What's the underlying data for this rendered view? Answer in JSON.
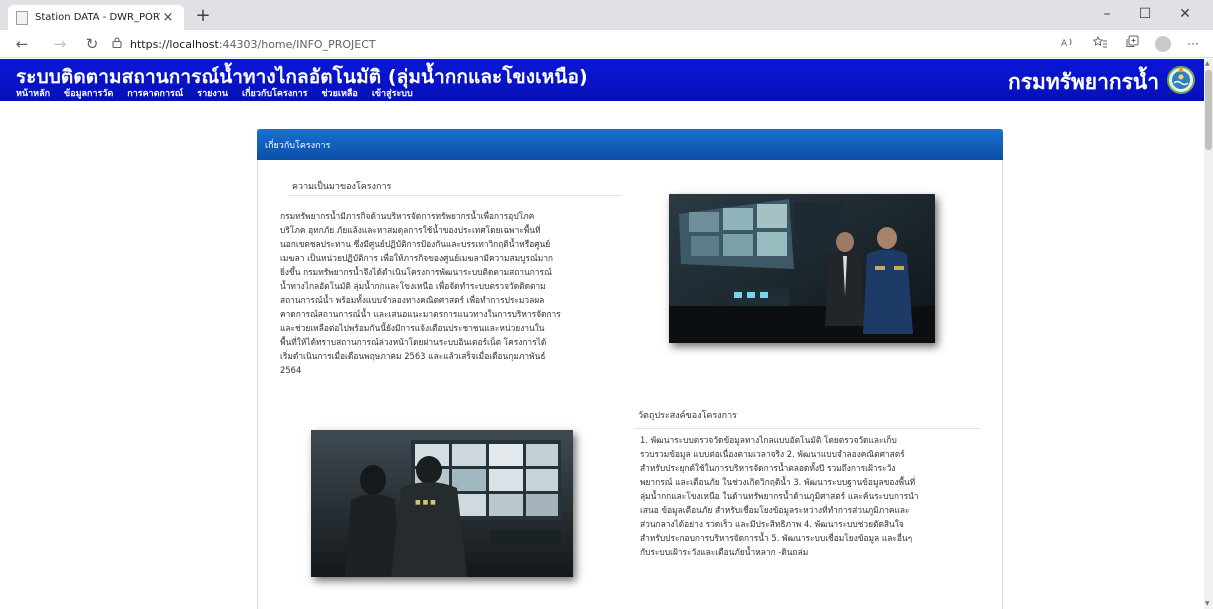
{
  "browser": {
    "tab_title": "Station DATA - DWR_PORTAL",
    "tab_close": "×",
    "new_tab": "+",
    "url_host": "https://localhost",
    "url_rest": ":44303/home/INFO_PROJECT"
  },
  "site": {
    "title": "ระบบติดตามสถานการณ์น้ำทางไกลอัตโนมัติ (ลุ่มน้ำกกและโขงเหนือ)",
    "department": "กรมทรัพยากรน้ำ",
    "nav": [
      "หน้าหลัก",
      "ข้อมูลการวัด",
      "การคาดการณ์",
      "รายงาน",
      "เกี่ยวกับโครงการ",
      "ช่วยเหลือ",
      "เข้าสู่ระบบ"
    ]
  },
  "panel": {
    "title": "เกี่ยวกับโครงการ",
    "background_title": "ความเป็นมาของโครงการ",
    "background_lines": [
      "กรมทรัพยากรน้ำมีภารกิจด้านบริหารจัดการทรัพยากรน้ำเพื่อการอุปโภค",
      "บริโภค อุทกภัย ภัยแล้งและหาสมดุลการใช้น้ำของประเทศโดยเฉพาะพื้นที่",
      "นอกเขตชลประทาน ซึ่งมีศูนย์ปฏิบัติการป้องกันและบรรเทาวิกฤติน้ำหรือศูนย์",
      "เมฆลา เป็นหน่วยปฏิบัติการ เพื่อให้ภารกิจของศูนย์เมฆลามีความสมบูรณ์มาก",
      "ยิ่งขึ้น กรมทรัพยากรน้ำจึงได้ดำเนินโครงการพัฒนาระบบติดตามสถานการณ์",
      "น้ำทางไกลอัตโนมัติ ลุ่มน้ำกกและโขงเหนือ เพื่อจัดทำระบบตรวจวัดติดตาม",
      "สถานการณ์น้ำ พร้อมทั้งแบบจำลองทางคณิตศาสตร์ เพื่อทำการประมวลผล",
      "คาดการณ์สถานการณ์น้ำ และเสนอแนะมาตรการแนวทางในการบริหารจัดการ",
      "และช่วยเหลือต่อไปพร้อมกันนี้ยังมีการแจ้งเตือนประชาชนและหน่วยงานใน",
      "พื้นที่ให้ได้ทราบสถานการณ์ล่วงหน้าโดยผ่านระบบอินเตอร์เน็ต โครงการได้",
      "เริ่มดำเนินการเมื่อเดือนพฤษภาคม 2563 และแล้วเสร็จเมื่อเดือนกุมภาพันธ์",
      "2564"
    ],
    "objective_title": "วัตถุประสงค์ของโครงการ",
    "objective_lines": [
      "1. พัฒนาระบบตรวจวัดข้อมูลทางไกลแบบอัตโนมัติ โดยตรวจวัดและเก็บ",
      "รวบรวมข้อมูล แบบต่อเนื่องตามเวลาจริง 2. พัฒนาแบบจำลองคณิตศาสตร์",
      "สำหรับประยุกต์ใช้ในการบริหารจัดการน้ำตลอดทั้งปี รวมถึงการเฝ้าระวัง",
      "พยากรณ์ และเตือนภัย ในช่วงเกิดวิกฤติน้ำ 3. พัฒนาระบบฐานข้อมูลของพื้นที่",
      "ลุ่มน้ำกกและโขงเหนือ ในด้านทรัพยากรน้ำด้านภูมิศาสตร์ และค้นระบบการนำ",
      "เสนอ ข้อมูลเตือนภัย สำหรับเชื่อมโยงข้อมูลระหว่างที่ทำการส่วนภูมิภาคและ",
      "ส่วนกลางได้อย่าง รวดเร็ว และมีประสิทธิภาพ 4. พัฒนาระบบช่วยตัดสินใจ",
      "สำหรับประกอบการบริหารจัดการน้ำ 5. พัฒนาระบบเชื่อมโยงข้อมูล และอื่นๆ",
      "กับระบบเฝ้าระวังและเตือนภัยน้ำหลาก -ดินถล่ม"
    ]
  },
  "icons": {
    "back": "back-arrow-icon",
    "forward": "forward-arrow-icon",
    "refresh": "refresh-icon",
    "lock": "lock-icon"
  },
  "colors": {
    "header_blue": "#0a17d8",
    "panel_header_blue": "#1b6fd1"
  }
}
